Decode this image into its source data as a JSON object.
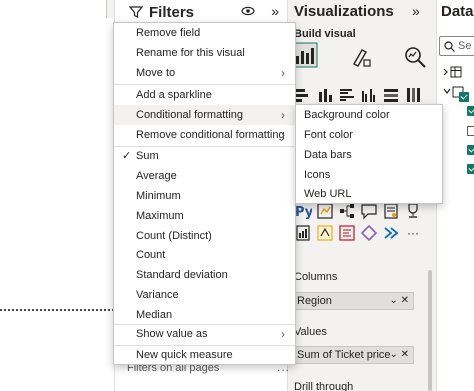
{
  "filters_pane": {
    "title": "Filters",
    "collapse_glyph": "»",
    "footer_label": "Filters on all pages",
    "footer_more": "..."
  },
  "context_menu": {
    "group1": [
      {
        "label": "Remove field",
        "has_submenu": false
      },
      {
        "label": "Rename for this visual",
        "has_submenu": false
      },
      {
        "label": "Move to",
        "has_submenu": true
      }
    ],
    "group2": [
      {
        "label": "Add a sparkline",
        "has_submenu": false
      },
      {
        "label": "Conditional formatting",
        "has_submenu": true
      },
      {
        "label": "Remove conditional formatting",
        "has_submenu": true
      }
    ],
    "aggregations": [
      {
        "label": "Sum",
        "checked": true
      },
      {
        "label": "Average",
        "checked": false
      },
      {
        "label": "Minimum",
        "checked": false
      },
      {
        "label": "Maximum",
        "checked": false
      },
      {
        "label": "Count (Distinct)",
        "checked": false
      },
      {
        "label": "Count",
        "checked": false
      },
      {
        "label": "Standard deviation",
        "checked": false
      },
      {
        "label": "Variance",
        "checked": false
      },
      {
        "label": "Median",
        "checked": false
      },
      {
        "label": "Show value as",
        "checked": false,
        "has_submenu": true
      }
    ],
    "group4": [
      {
        "label": "New quick measure",
        "has_submenu": false
      }
    ],
    "submenu_glyph": "›",
    "check_glyph": "✓"
  },
  "submenu": {
    "items": [
      "Background color",
      "Font color",
      "Data bars",
      "Icons",
      "Web URL"
    ]
  },
  "viz_pane": {
    "title": "Visualizations",
    "collapse_glyph": "»",
    "build_visual": "Build visual",
    "more_glyph": "···",
    "sections": {
      "columns_label": "Columns",
      "columns_field": "Region",
      "values_label": "Values",
      "values_field": "Sum of Ticket price",
      "drill_label": "Drill through"
    },
    "pill_controls": "⌄ ✕"
  },
  "data_pane": {
    "title": "Data",
    "search_placeholder": "Se"
  },
  "colors": {
    "accent": "#117865",
    "menu_border": "#c8c6c4",
    "pane_bg": "#f3f2f1",
    "text": "#252423"
  }
}
